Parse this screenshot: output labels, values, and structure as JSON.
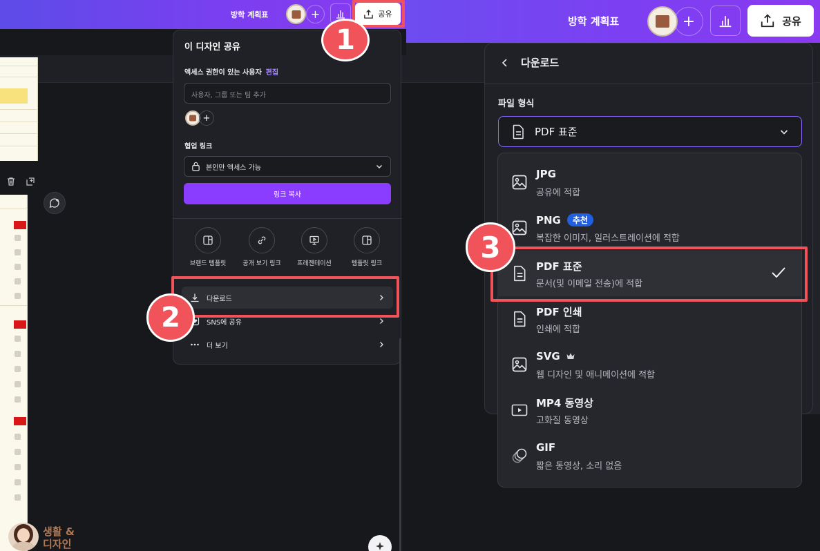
{
  "left": {
    "topbar": {
      "doc_title": "방학 계획표",
      "share_label": "공유"
    },
    "share_panel": {
      "title": "이 디자인 공유",
      "access_label": "액세스 권한이 있는 사용자",
      "edit_link": "편집",
      "add_placeholder": "사용자, 그룹 또는 팀 추가",
      "collab_label": "협업 링크",
      "access_value": "본인만 액세스 가능",
      "copy_link": "링크 복사",
      "tiles": [
        {
          "label": "브랜드 템플릿",
          "icon": "template-icon"
        },
        {
          "label": "공개 보기 링크",
          "icon": "link-icon"
        },
        {
          "label": "프레젠테이션",
          "icon": "presentation-icon"
        },
        {
          "label": "템플릿 링크",
          "icon": "template-link-icon"
        }
      ],
      "menu": [
        {
          "label": "다운로드",
          "icon": "download-icon"
        },
        {
          "label": "SNS에 공유",
          "icon": "heart-icon"
        },
        {
          "label": "더 보기",
          "icon": "more-icon"
        }
      ]
    }
  },
  "right": {
    "topbar": {
      "doc_title": "방학 계획표",
      "share_label": "공유"
    },
    "download_panel": {
      "title": "다운로드",
      "file_type_label": "파일 형식",
      "selected": "PDF 표준",
      "formats": [
        {
          "name": "JPG",
          "desc": "공유에 적합",
          "icon": "image-icon"
        },
        {
          "name": "PNG",
          "desc": "복잡한 이미지, 일러스트레이션에 적합",
          "badge": "추천",
          "icon": "image-icon"
        },
        {
          "name": "PDF 표준",
          "desc": "문서(및 이메일 전송)에 적합",
          "selected": true,
          "icon": "document-icon"
        },
        {
          "name": "PDF 인쇄",
          "desc": "인쇄에 적합",
          "icon": "document-icon"
        },
        {
          "name": "SVG",
          "desc": "웹 디자인 및 애니메이션에 적합",
          "premium": true,
          "icon": "image-icon"
        },
        {
          "name": "MP4 동영상",
          "desc": "고화질 동영상",
          "icon": "video-icon"
        },
        {
          "name": "GIF",
          "desc": "짧은 동영상, 소리 없음",
          "icon": "gif-icon"
        }
      ]
    }
  },
  "annotations": {
    "step1": "1",
    "step2": "2",
    "step3": "3"
  },
  "watermark": {
    "line1": "생활 &",
    "line2": "디자인"
  },
  "colors": {
    "accent_purple": "#8b3dff",
    "highlight_red": "#f0535a",
    "panel_bg": "#202126"
  }
}
